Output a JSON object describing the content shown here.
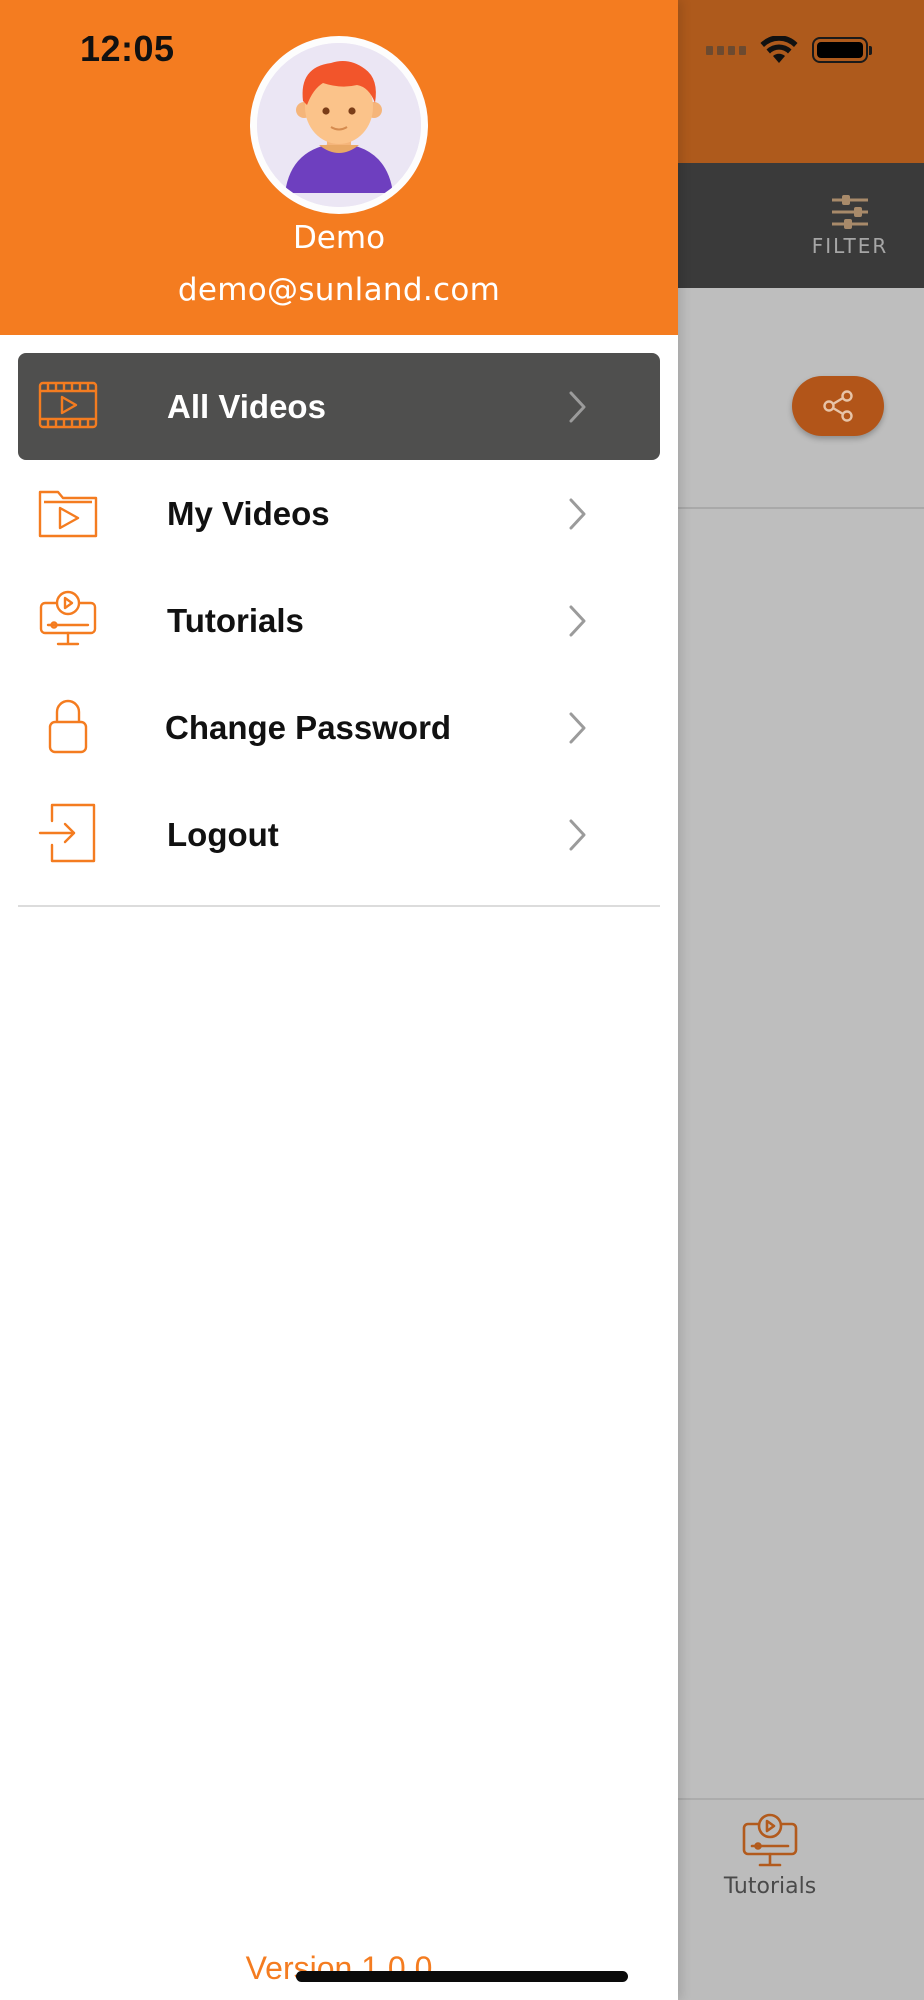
{
  "status_bar": {
    "time": "12:05"
  },
  "background": {
    "filter_label": "FILTER",
    "tab_label": "Tutorials"
  },
  "drawer": {
    "user_name": "Demo",
    "user_email": "demo@sunland.com",
    "menu": [
      {
        "label": "All Videos",
        "icon": "film-icon",
        "active": true
      },
      {
        "label": "My Videos",
        "icon": "video-folder-icon",
        "active": false
      },
      {
        "label": "Tutorials",
        "icon": "tutorial-monitor-icon",
        "active": false
      },
      {
        "label": "Change Password",
        "icon": "lock-icon",
        "active": false
      },
      {
        "label": "Logout",
        "icon": "logout-icon",
        "active": false
      }
    ],
    "version": "Version 1.0.0"
  },
  "colors": {
    "accent": "#f47c20",
    "active_row": "#4f4f4e",
    "dimmed_share": "#b25519"
  }
}
